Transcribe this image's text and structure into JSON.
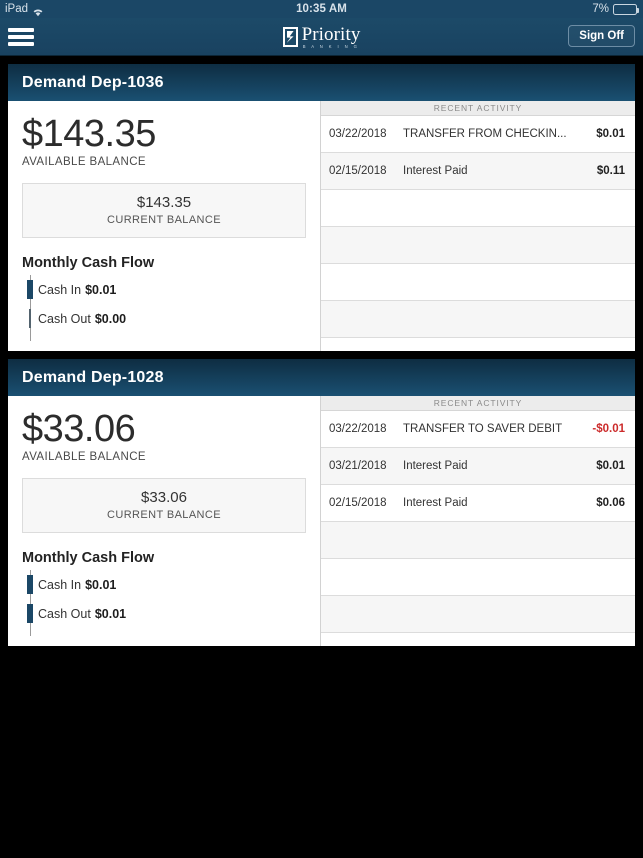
{
  "status_bar": {
    "carrier": "iPad",
    "wifi_icon": "wifi-icon",
    "time": "10:35 AM",
    "battery_percent": "7%",
    "battery_level": 7,
    "battery_color": "#e0443e"
  },
  "navbar": {
    "menu_icon": "hamburger-menu-icon",
    "brand_name": "Priority",
    "brand_sub": "B A N K I N G",
    "signoff_label": "Sign Off",
    "background_color": "#1c4a68"
  },
  "accounts": [
    {
      "title": "Demand Dep-1036",
      "available_amount": "$143.35",
      "available_label": "AVAILABLE BALANCE",
      "current_amount": "$143.35",
      "current_label": "CURRENT BALANCE",
      "cashflow_title": "Monthly Cash Flow",
      "cash_in_label": "Cash In",
      "cash_in_value": "$0.01",
      "cash_out_label": "Cash Out",
      "cash_out_value": "$0.00",
      "activity_header": "RECENT ACTIVITY",
      "transactions": [
        {
          "date": "03/22/2018",
          "description": "TRANSFER FROM CHECKIN...",
          "amount": "$0.01",
          "negative": false
        },
        {
          "date": "02/15/2018",
          "description": "Interest Paid",
          "amount": "$0.11",
          "negative": false
        }
      ],
      "empty_rows": 4
    },
    {
      "title": "Demand Dep-1028",
      "available_amount": "$33.06",
      "available_label": "AVAILABLE BALANCE",
      "current_amount": "$33.06",
      "current_label": "CURRENT BALANCE",
      "cashflow_title": "Monthly Cash Flow",
      "cash_in_label": "Cash In",
      "cash_in_value": "$0.01",
      "cash_out_label": "Cash Out",
      "cash_out_value": "$0.01",
      "activity_header": "RECENT ACTIVITY",
      "transactions": [
        {
          "date": "03/22/2018",
          "description": "TRANSFER TO SAVER DEBIT",
          "amount": "-$0.01",
          "negative": true
        },
        {
          "date": "03/21/2018",
          "description": "Interest Paid",
          "amount": "$0.01",
          "negative": false
        },
        {
          "date": "02/15/2018",
          "description": "Interest Paid",
          "amount": "$0.06",
          "negative": false
        }
      ],
      "empty_rows": 3
    }
  ]
}
